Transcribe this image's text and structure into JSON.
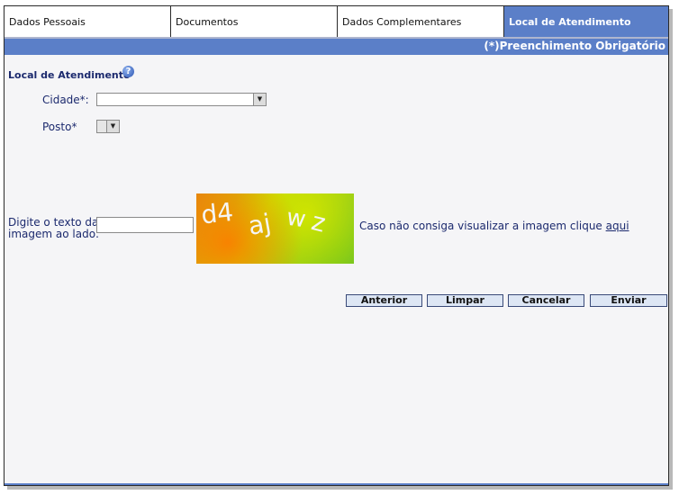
{
  "tabs": [
    {
      "label": "Dados Pessoais",
      "active": false
    },
    {
      "label": "Documentos",
      "active": false
    },
    {
      "label": "Dados Complementares",
      "active": false
    },
    {
      "label": "Local de Atendimento",
      "active": true
    }
  ],
  "required_note": "(*)Preenchimento Obrigatório",
  "section": {
    "title": "Local de Atendimento",
    "help_icon": "question-circle-icon"
  },
  "fields": {
    "cidade": {
      "label": "Cidade*:",
      "value": ""
    },
    "posto": {
      "label": "Posto*",
      "value": ""
    }
  },
  "captcha": {
    "label_line1": "Digite o texto da",
    "label_line2": "imagem ao lado:",
    "input_value": "",
    "image_text": [
      "d4",
      "aj",
      "w",
      "z"
    ],
    "help_text": "Caso não consiga visualizar a imagem clique ",
    "help_link": "aqui"
  },
  "buttons": {
    "anterior": "Anterior",
    "limpar": "Limpar",
    "cancelar": "Cancelar",
    "enviar": "Enviar"
  },
  "colors": {
    "accent": "#5b7fc8",
    "label_text": "#1c2a6e",
    "button_bg": "#dde6f4"
  }
}
